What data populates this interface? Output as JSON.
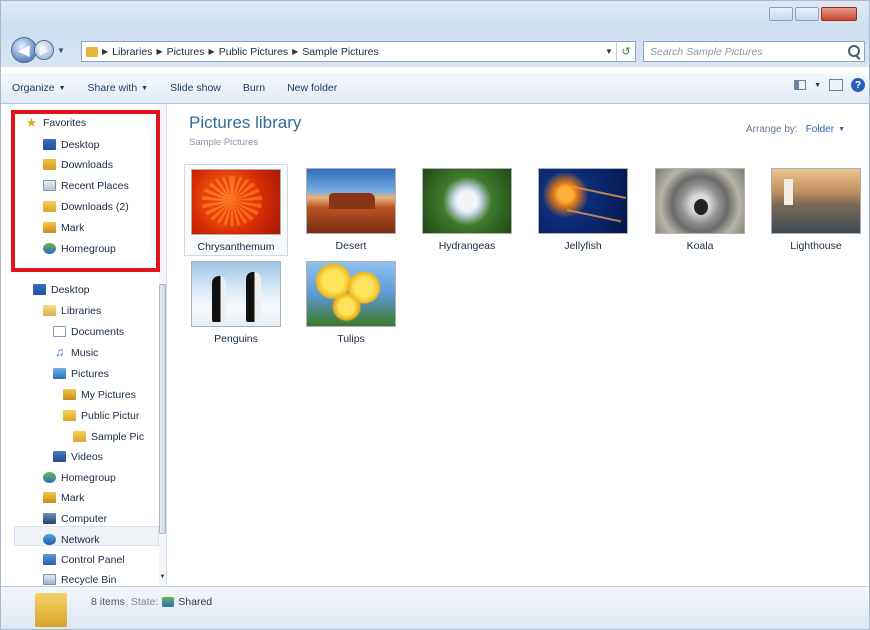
{
  "address": {
    "crumbs": [
      "Libraries",
      "Pictures",
      "Public Pictures",
      "Sample Pictures"
    ]
  },
  "search": {
    "placeholder": "Search Sample Pictures"
  },
  "toolbar": {
    "organize": "Organize",
    "share_with": "Share with",
    "slide_show": "Slide show",
    "burn": "Burn",
    "new_folder": "New folder"
  },
  "favorites": {
    "header": "Favorites",
    "items": [
      "Desktop",
      "Downloads",
      "Recent Places",
      "Downloads (2)",
      "Mark",
      "Homegroup"
    ]
  },
  "tree": {
    "items": [
      "Desktop",
      "Libraries",
      "Documents",
      "Music",
      "Pictures",
      "My Pictures",
      "Public Pictur",
      "Sample Pic",
      "Videos",
      "Homegroup",
      "Mark",
      "Computer",
      "Network",
      "Control Panel",
      "Recycle Bin"
    ]
  },
  "content": {
    "title": "Pictures library",
    "subtitle": "Sample Pictures",
    "arrange_label": "Arrange by:",
    "arrange_value": "Folder",
    "files": [
      "Chrysanthemum",
      "Desert",
      "Hydrangeas",
      "Jellyfish",
      "Koala",
      "Lighthouse",
      "Penguins",
      "Tulips"
    ]
  },
  "status": {
    "count": "8 items",
    "state_label": "State:",
    "state_value": "Shared"
  },
  "colors": {
    "highlight_box": "#e2141b",
    "title_accent": "#2c6e9b"
  }
}
